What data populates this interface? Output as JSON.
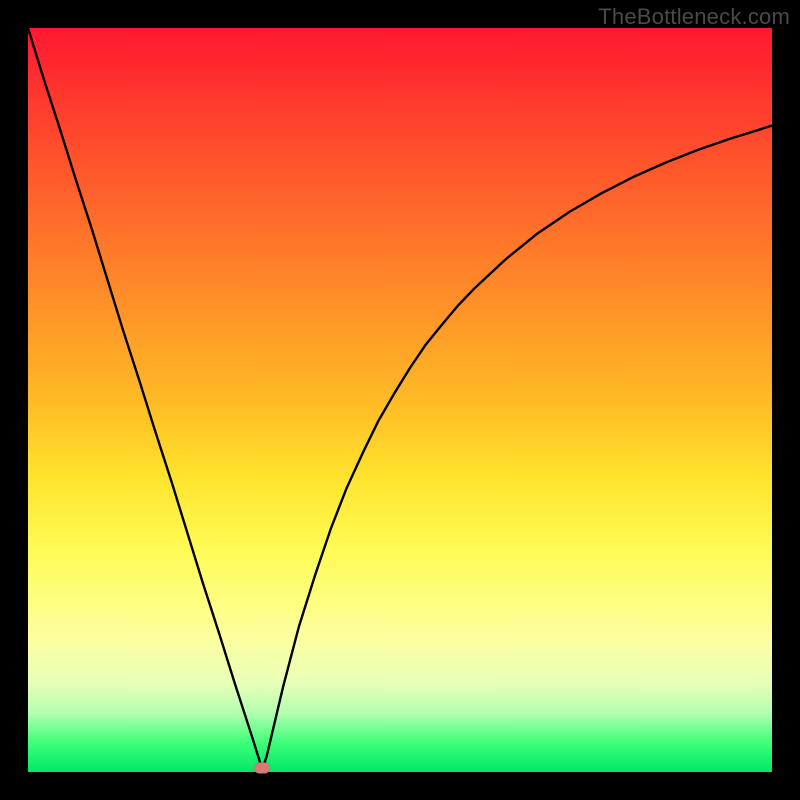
{
  "watermark": "TheBottleneck.com",
  "chart_data": {
    "type": "line",
    "title": "",
    "xlabel": "",
    "ylabel": "",
    "xlim": [
      0,
      1
    ],
    "ylim": [
      0,
      1
    ],
    "marker": {
      "x": 0.315,
      "y": 0.005
    },
    "series": [
      {
        "name": "curve",
        "x": [
          0.0,
          0.021,
          0.043,
          0.064,
          0.086,
          0.107,
          0.128,
          0.15,
          0.171,
          0.193,
          0.214,
          0.235,
          0.257,
          0.278,
          0.3,
          0.315,
          0.321,
          0.343,
          0.364,
          0.386,
          0.407,
          0.428,
          0.45,
          0.471,
          0.493,
          0.514,
          0.535,
          0.557,
          0.578,
          0.6,
          0.643,
          0.685,
          0.728,
          0.771,
          0.814,
          0.857,
          0.9,
          0.943,
          0.985,
          1.0
        ],
        "y": [
          1.0,
          0.932,
          0.864,
          0.797,
          0.729,
          0.661,
          0.593,
          0.525,
          0.458,
          0.39,
          0.322,
          0.254,
          0.186,
          0.119,
          0.051,
          0.003,
          0.022,
          0.115,
          0.195,
          0.265,
          0.327,
          0.381,
          0.429,
          0.472,
          0.51,
          0.544,
          0.575,
          0.602,
          0.627,
          0.65,
          0.69,
          0.724,
          0.753,
          0.778,
          0.8,
          0.819,
          0.836,
          0.851,
          0.864,
          0.869
        ]
      }
    ],
    "background_gradient": {
      "top_color": "#ff1830",
      "mid_color": "#ffe22c",
      "bottom_color": "#00e868"
    }
  }
}
